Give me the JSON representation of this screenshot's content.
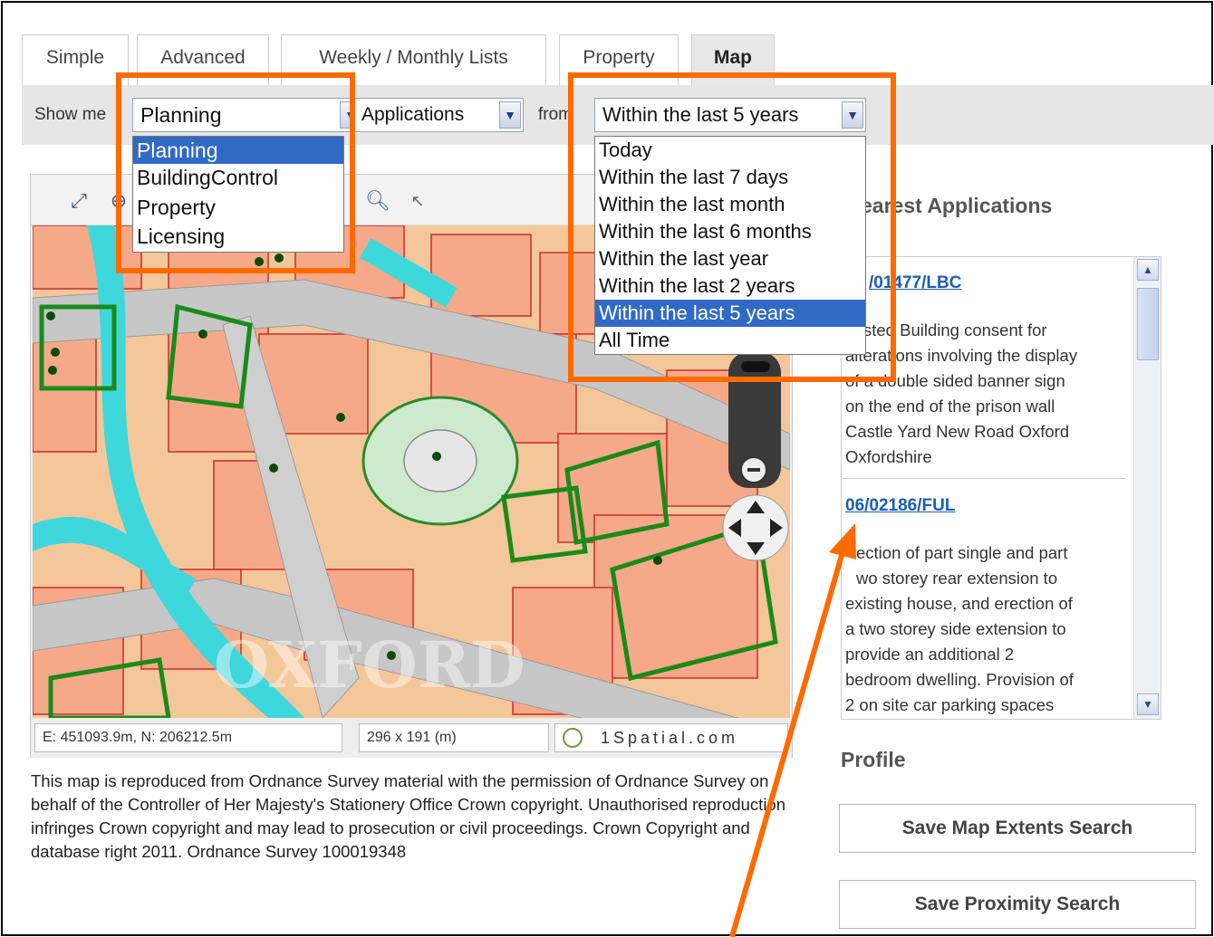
{
  "tabs": [
    "Simple",
    "Advanced",
    "Weekly / Monthly Lists",
    "Property",
    "Map"
  ],
  "active_tab": "Map",
  "filter": {
    "show_me_label": "Show me",
    "category_value": "Planning",
    "category_options": [
      "Planning",
      "BuildingControl",
      "Property",
      "Licensing"
    ],
    "type_value": "Applications",
    "from_label": "from",
    "period_value": "Within the last 5 years",
    "period_options": [
      "Today",
      "Within the last 7 days",
      "Within the last month",
      "Within the last 6 months",
      "Within the last year",
      "Within the last 2 years",
      "Within the last 5 years",
      "All Time"
    ]
  },
  "map": {
    "coordinates": "E: 451093.9m, N: 206212.5m",
    "extent": "296 x 191 (m)",
    "brand": "1Spatial.com",
    "watermark": "OXFORD"
  },
  "copyright_text": "This map is reproduced from Ordnance Survey material with the permission of Ordnance Survey on behalf of the Controller of Her Majesty's Stationery Office Crown copyright. Unauthorised reproduction infringes Crown copyright and may lead to prosecution or civil proceedings. Crown Copyright and database right 2011. Ordnance Survey 100019348",
  "side": {
    "nearest_title": "earest Applications",
    "results": [
      {
        "ref": "/01477/LBC",
        "lines": [
          "sted Building consent for",
          "alterations involving the display",
          "of a double sided banner sign",
          "on the end of the prison wall",
          "Castle Yard New Road Oxford",
          "Oxfordshire"
        ]
      },
      {
        "ref": "06/02186/FUL",
        "lines": [
          "ection of part single and part",
          "wo storey rear extension to",
          "existing house, and erection of",
          "a two storey side extension to",
          "provide an additional 2",
          "bedroom dwelling. Provision of",
          "2 on site car parking spaces"
        ]
      }
    ],
    "profile_title": "Profile",
    "save_extents_label": "Save Map Extents Search",
    "save_proximity_label": "Save Proximity Search"
  },
  "colors": {
    "highlight": "#ff6a00",
    "selected_option": "#316ac5",
    "link": "#1a5fb4"
  }
}
